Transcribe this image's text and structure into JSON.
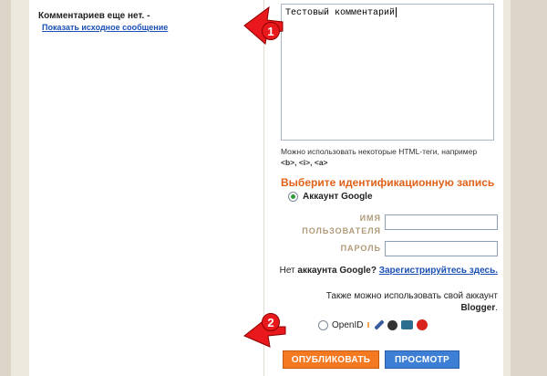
{
  "left": {
    "no_comments": "Комментариев еще нет. -",
    "show_source": "Показать исходное сообщение"
  },
  "comment": {
    "value": "Тестовый комментарий"
  },
  "hint": {
    "text": "Можно использовать некоторые HTML-теги, например",
    "tags": "<b>, <i>, <a>"
  },
  "identity": {
    "title": "Выберите идентификационную запись",
    "google_account": "Аккаунт Google",
    "username_label_1": "ИМЯ",
    "username_label_2": "ПОЛЬЗОВАТЕЛЯ",
    "password_label": "ПАРОЛЬ",
    "no_account_prefix": "Нет",
    "no_account_bold": "аккаунта Google?",
    "register_link": "Зарегистрируйтесь здесь.",
    "also_text": "Также можно использовать свой аккаунт",
    "blogger": "Blogger",
    "openid_label": "OpenID"
  },
  "buttons": {
    "publish": "ОПУБЛИКОВАТЬ",
    "preview": "ПРОСМОТР"
  },
  "annotations": {
    "badge_1": "1",
    "badge_2": "2"
  },
  "colors": {
    "heading": "#e0621a",
    "link": "#1a4fb5",
    "publish": "#f47920",
    "preview": "#3d7fd4",
    "annotation": "#e8181c"
  }
}
